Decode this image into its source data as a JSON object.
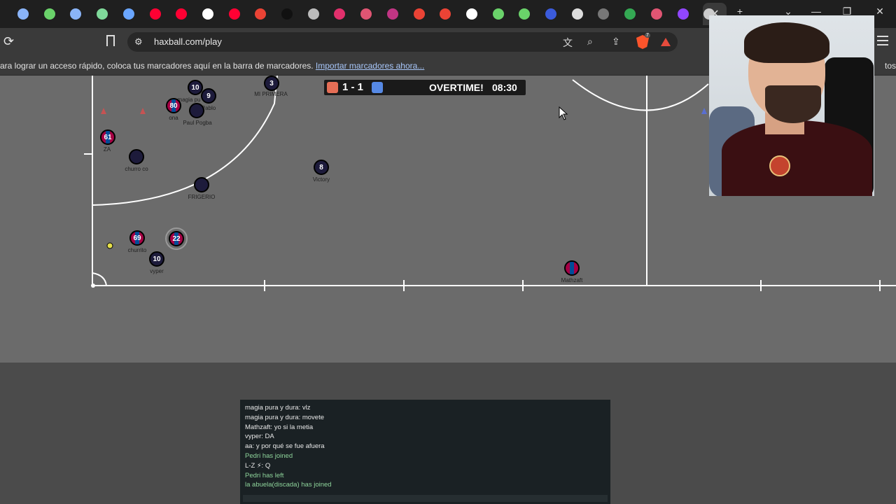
{
  "browser": {
    "tabs": [
      {
        "icon": "tab-icon-1",
        "color": "#8ab4f8"
      },
      {
        "icon": "tab-icon-2",
        "color": "#6ad26a"
      },
      {
        "icon": "tab-icon-3",
        "color": "#8ab4f8"
      },
      {
        "icon": "tab-icon-4",
        "color": "#7fd99a"
      },
      {
        "icon": "tab-icon-5",
        "color": "#6aa6ff"
      },
      {
        "icon": "youtube-icon",
        "color": "#ff0033"
      },
      {
        "icon": "youtube-icon",
        "color": "#ff0033"
      },
      {
        "icon": "google-icon",
        "color": "#ffffff"
      },
      {
        "icon": "youtube-icon",
        "color": "#ff0033"
      },
      {
        "icon": "gmail-icon",
        "color": "#ea4335"
      },
      {
        "icon": "tiktok-icon",
        "color": "#111111"
      },
      {
        "icon": "tab-icon-12",
        "color": "#bbbbbb"
      },
      {
        "icon": "instagram-icon",
        "color": "#e1306c"
      },
      {
        "icon": "tab-icon-14",
        "color": "#e05573"
      },
      {
        "icon": "tab-icon-15",
        "color": "#c13584"
      },
      {
        "icon": "gmail-icon",
        "color": "#ea4335"
      },
      {
        "icon": "gmail-icon",
        "color": "#ea4335"
      },
      {
        "icon": "google-icon",
        "color": "#ffffff"
      },
      {
        "icon": "tab-icon-19",
        "color": "#6ad26a"
      },
      {
        "icon": "tab-icon-20",
        "color": "#6ad26a"
      },
      {
        "icon": "tab-icon-21",
        "color": "#3b5bdb"
      },
      {
        "icon": "tab-icon-22",
        "color": "#dddddd"
      },
      {
        "icon": "tab-icon-23",
        "color": "#777777"
      },
      {
        "icon": "maps-icon",
        "color": "#34a853"
      },
      {
        "icon": "tab-icon-25",
        "color": "#e05573"
      },
      {
        "icon": "twitch-icon",
        "color": "#9146ff"
      },
      {
        "icon": "brave-icon",
        "color": "#cccccc"
      }
    ],
    "url": "haxball.com/play",
    "bookmarks_text": "ara lograr un acceso rápido, coloca tus marcadores aquí en la barra de marcadores.",
    "bookmarks_link": "Importar marcadores ahora...",
    "bookmarks_right": "tos",
    "brave_badge": "7"
  },
  "scoreboard": {
    "score": "1 - 1",
    "status": "OVERTIME!",
    "time": "08:30",
    "red_color": "#e56e56",
    "blue_color": "#5689e5"
  },
  "players": [
    {
      "number": "10",
      "name": "magia pu",
      "team": "blue"
    },
    {
      "number": "9",
      "name": "Pablo",
      "team": "blue"
    },
    {
      "number": "80",
      "name": "ona",
      "team": "barca"
    },
    {
      "number": "",
      "name": "Paul Pogba",
      "team": "blue"
    },
    {
      "number": "3",
      "name": "MI PRIMERA",
      "team": "blue"
    },
    {
      "number": "61",
      "name": "ZA",
      "team": "barca"
    },
    {
      "number": "",
      "name": "churro co",
      "team": "blue"
    },
    {
      "number": "8",
      "name": "Victory",
      "team": "blue"
    },
    {
      "number": "",
      "name": "FRIGERIO",
      "team": "blue"
    },
    {
      "number": "69",
      "name": "churrito",
      "team": "barca"
    },
    {
      "number": "22",
      "name": "",
      "team": "barca"
    },
    {
      "number": "10",
      "name": "vyper",
      "team": "blue"
    },
    {
      "number": "",
      "name": "Mathzaft",
      "team": "red"
    }
  ],
  "chat": [
    {
      "text": "magia pura y dura: vlz",
      "type": "msg"
    },
    {
      "text": "magia pura y dura: movete",
      "type": "msg"
    },
    {
      "text": "Mathzaft: yo si la metia",
      "type": "msg"
    },
    {
      "text": "vyper: DA",
      "type": "msg"
    },
    {
      "text": "aa: y por qué se fue afuera",
      "type": "msg"
    },
    {
      "text": "Pedri has joined",
      "type": "sys"
    },
    {
      "text": "L-Z ⚡: Q",
      "type": "msg"
    },
    {
      "text": "Pedri has left",
      "type": "sys"
    },
    {
      "text": "la abuela(discada) has joined",
      "type": "sys"
    }
  ]
}
